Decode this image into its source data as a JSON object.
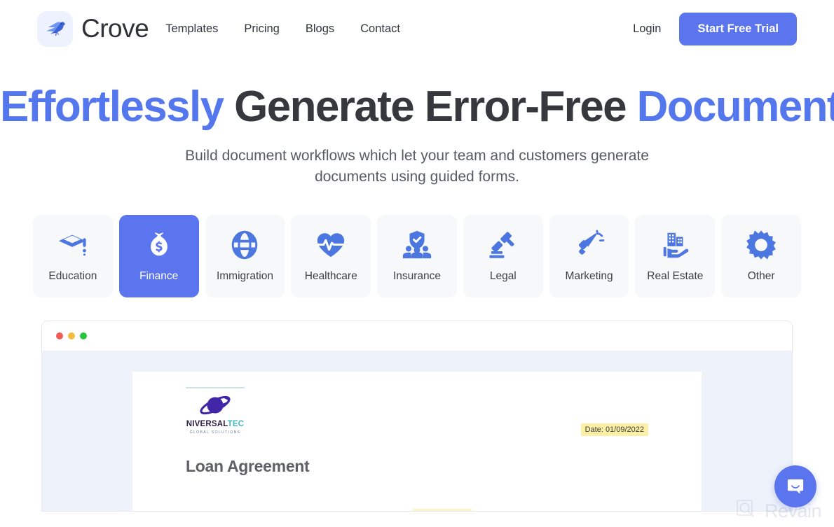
{
  "header": {
    "logo_icon": "crow-logo-icon",
    "brand_name": "Crove",
    "nav": [
      {
        "label": "Templates"
      },
      {
        "label": "Pricing"
      },
      {
        "label": "Blogs"
      },
      {
        "label": "Contact"
      }
    ],
    "login_label": "Login",
    "cta_label": "Start Free Trial",
    "cta_color": "#5b75ee"
  },
  "hero": {
    "headline_part1": "Effortlessly",
    "headline_part2": "Generate Error-Free",
    "headline_part3": "Documents",
    "accent_color": "#5577ee",
    "subheadline": "Build document workflows which let your team and customers generate documents using guided forms."
  },
  "categories": {
    "active_index": 1,
    "items": [
      {
        "label": "Education",
        "icon": "graduation-cap-icon",
        "active": false
      },
      {
        "label": "Finance",
        "icon": "money-bag-icon",
        "active": true
      },
      {
        "label": "Immigration",
        "icon": "globe-icon",
        "active": false
      },
      {
        "label": "Healthcare",
        "icon": "heart-pulse-icon",
        "active": false
      },
      {
        "label": "Insurance",
        "icon": "people-shield-icon",
        "active": false
      },
      {
        "label": "Legal",
        "icon": "gavel-icon",
        "active": false
      },
      {
        "label": "Marketing",
        "icon": "megaphone-icon",
        "active": false
      },
      {
        "label": "Real Estate",
        "icon": "building-hand-icon",
        "active": false
      },
      {
        "label": "Other",
        "icon": "gear-icon",
        "active": false
      }
    ]
  },
  "browser_preview": {
    "window_dots": [
      "red",
      "yellow",
      "green"
    ],
    "document": {
      "logo_name_part1": "NIVERSAL",
      "logo_name_part2": "TEC",
      "logo_tagline": "GLOBAL SOLUTIONS",
      "logo_icon": "planet-saturn-icon",
      "date_label": "Date: 01/09/2022",
      "title": "Loan Agreement",
      "highlight_color": "#fbf0a6"
    }
  },
  "chat_widget": {
    "icon": "chat-bubble-icon",
    "color": "#5b75ee"
  },
  "watermark": {
    "text": "Revain",
    "icon": "revain-magnifier-icon"
  }
}
